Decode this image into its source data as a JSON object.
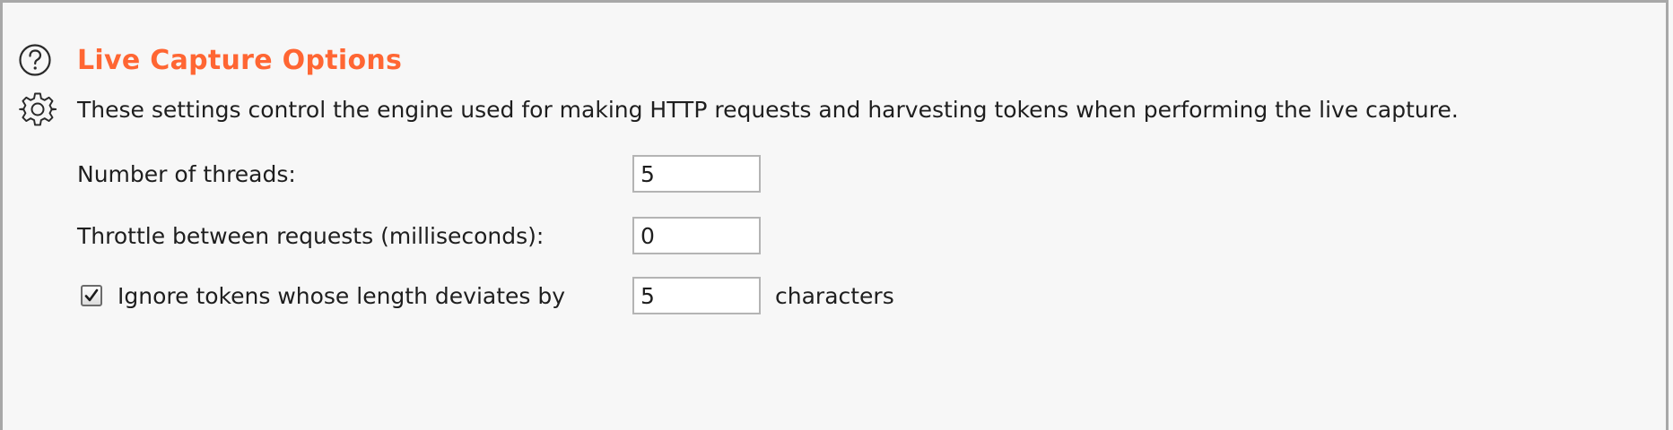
{
  "section": {
    "title": "Live Capture Options",
    "description": "These settings control the engine used for making HTTP requests and harvesting tokens when performing the live capture.",
    "help_icon": "help-circle-icon",
    "settings_icon": "gear-icon",
    "title_color": "#ff6633"
  },
  "fields": {
    "threads": {
      "label": "Number of threads:",
      "value": "5"
    },
    "throttle": {
      "label": "Throttle between requests (milliseconds):",
      "value": "0"
    },
    "ignore_tokens": {
      "checked": true,
      "label": "Ignore tokens whose length deviates by",
      "value": "5",
      "suffix": "characters"
    }
  }
}
